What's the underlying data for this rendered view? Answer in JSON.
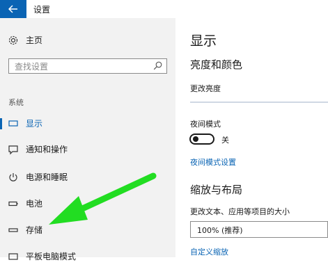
{
  "window": {
    "title": "设置"
  },
  "sidebar": {
    "home_label": "主页",
    "search_placeholder": "查找设置",
    "section_label": "系统",
    "items": [
      {
        "label": "显示",
        "icon": "monitor-icon",
        "active": true
      },
      {
        "label": "通知和操作",
        "icon": "notification-icon",
        "active": false
      },
      {
        "label": "电源和睡眠",
        "icon": "power-icon",
        "active": false
      },
      {
        "label": "电池",
        "icon": "battery-icon",
        "active": false
      },
      {
        "label": "存储",
        "icon": "storage-icon",
        "active": false
      },
      {
        "label": "平板电脑模式",
        "icon": "tablet-mode-icon",
        "active": false
      }
    ]
  },
  "main": {
    "page_title": "显示",
    "brightness_heading": "亮度和颜色",
    "brightness_label": "更改亮度",
    "night_mode_label": "夜间模式",
    "night_mode_state": "关",
    "night_mode_settings_link": "夜间模式设置",
    "scale_heading": "缩放与布局",
    "scale_label": "更改文本、应用等项目的大小",
    "scale_value": "100% (推荐)",
    "custom_scale_link": "自定义缩放"
  },
  "colors": {
    "accent": "#0a64b4",
    "annotation_arrow": "#22dd22",
    "sidebar_bg": "#f2f2f2"
  }
}
